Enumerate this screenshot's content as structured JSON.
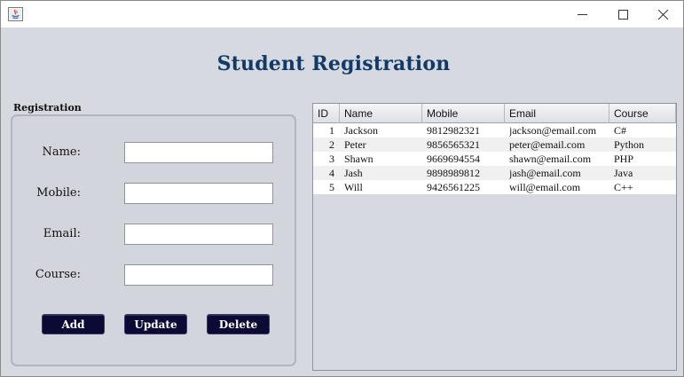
{
  "window": {
    "icon": "java-icon",
    "controls": [
      "minimize-icon",
      "maximize-icon",
      "close-icon"
    ]
  },
  "heading": "Student Registration",
  "registration": {
    "group_title": "Registration",
    "fields": [
      {
        "label": "Name:",
        "value": ""
      },
      {
        "label": "Mobile:",
        "value": ""
      },
      {
        "label": "Email:",
        "value": ""
      },
      {
        "label": "Course:",
        "value": ""
      }
    ],
    "buttons": {
      "add": "Add",
      "update": "Update",
      "delete": "Delete"
    }
  },
  "table": {
    "columns": [
      "ID",
      "Name",
      "Mobile",
      "Email",
      "Course"
    ],
    "rows": [
      [
        "1",
        "Jackson",
        "9812982321",
        "jackson@email.com",
        "C#"
      ],
      [
        "2",
        "Peter",
        "9856565321",
        "peter@email.com",
        "Python"
      ],
      [
        "3",
        "Shawn",
        "9669694554",
        "shawn@email.com",
        "PHP"
      ],
      [
        "4",
        "Jash",
        "9898989812",
        "jash@email.com",
        "Java"
      ],
      [
        "5",
        "Will",
        "9426561225",
        "will@email.com",
        "C++"
      ]
    ]
  },
  "colors": {
    "heading": "#123a66",
    "button_bg": "#0b0a35",
    "background": "#d6d9e0"
  }
}
